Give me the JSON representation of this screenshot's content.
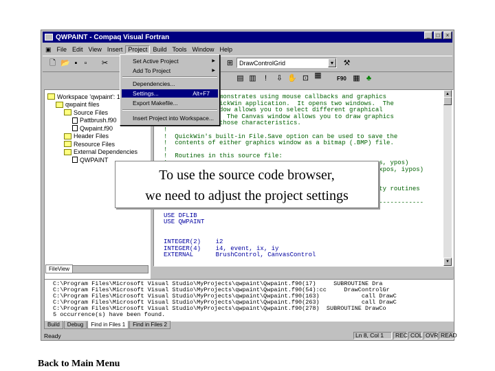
{
  "window": {
    "title": "QWPAINT - Compaq Visual Fortran"
  },
  "menubar": [
    "File",
    "Edit",
    "View",
    "Insert",
    "Project",
    "Build",
    "Tools",
    "Window",
    "Help"
  ],
  "toolbar": {
    "combo_value": "DrawControlGrid"
  },
  "project_menu": {
    "items": [
      {
        "label": "Set Active Project",
        "shortcut": "",
        "submenu": true
      },
      {
        "label": "Add To Project",
        "shortcut": "",
        "submenu": true
      },
      {
        "label": "Dependencies...",
        "shortcut": "",
        "submenu": false
      },
      {
        "label": "Settings...",
        "shortcut": "Alt+F7",
        "submenu": false,
        "selected": true
      },
      {
        "label": "Export Makefile...",
        "shortcut": "",
        "submenu": false
      },
      {
        "label": "Insert Project into Workspace...",
        "shortcut": "",
        "submenu": false
      }
    ]
  },
  "workspace_tree": {
    "items": [
      {
        "label": "Workspace 'qwpaint': 1 p",
        "level": 0,
        "icon": "workspace"
      },
      {
        "label": "qwpaint files",
        "level": 1,
        "icon": "project"
      },
      {
        "label": "Source Files",
        "level": 2,
        "icon": "folder"
      },
      {
        "label": "Pattbrush.f90",
        "level": 3,
        "icon": "file"
      },
      {
        "label": "Qwpaint.f90",
        "level": 3,
        "icon": "file"
      },
      {
        "label": "Header Files",
        "level": 2,
        "icon": "folder"
      },
      {
        "label": "Resource Files",
        "level": 2,
        "icon": "folder"
      },
      {
        "label": "External Dependencies",
        "level": 2,
        "icon": "folder"
      },
      {
        "label": "QWPAINT",
        "level": 3,
        "icon": "file"
      }
    ],
    "tab_label": "FileView"
  },
  "editor": {
    "lines": [
      {
        "t": "!      ...am demonstrates using mouse callbacks and graphics",
        "cls": "c"
      },
      {
        "t": "!      ... a QuickWin application.  It opens two windows.  The",
        "cls": "c"
      },
      {
        "t": "!      ...d window allows you to select different graphical",
        "cls": "c"
      },
      {
        "t": "!      ...tics.  The Canvas window allows you to draw graphics",
        "cls": "c"
      },
      {
        "t": "!      ...d on those characteristics.",
        "cls": "c"
      },
      {
        "t": "!",
        "cls": "c"
      },
      {
        "t": "!  QuickWin's built-in File.Save option can be used to save the",
        "cls": "c"
      },
      {
        "t": "!  contents of either graphics window as a bitmap (.BMP) file.",
        "cls": "c"
      },
      {
        "t": "!",
        "cls": "c"
      },
      {
        "t": "!  Routines in this source file:",
        "cls": "c"
      },
      {
        "t": "!                                                      xpos, ypos)",
        "cls": "c"
      },
      {
        "t": "!                                                      , ixpos, iypos)",
        "cls": "c"
      },
      {
        "t": "!",
        "cls": "c"
      },
      {
        "t": "!",
        "cls": "c"
      },
      {
        "t": "!                                                    utility routines",
        "cls": "c"
      },
      {
        "t": "!",
        "cls": "c"
      },
      {
        "t": "!---------------------------------------------------------------------",
        "cls": "c"
      },
      {
        "t": "",
        "cls": ""
      },
      {
        "t": "USE DFLIB",
        "cls": "k"
      },
      {
        "t": "USE QWPAINT",
        "cls": "k"
      },
      {
        "t": "",
        "cls": ""
      },
      {
        "t": "",
        "cls": ""
      },
      {
        "t": "INTEGER(2)    i2",
        "cls": "k"
      },
      {
        "t": "INTEGER(4)    i4, event, ix, iy",
        "cls": "k"
      },
      {
        "t": "EXTERNAL      BrushControl, CanvasControl",
        "cls": "k"
      }
    ]
  },
  "output_lines": [
    "C:\\Program Files\\Microsoft Visual Studio\\MyProjects\\qwpaint\\Qwpaint.f90(17)     SUBROUTINE Dra",
    "C:\\Program Files\\Microsoft Visual Studio\\MyProjects\\qwpaint\\Qwpaint.f90(54):cc     DrawControlGr",
    "C:\\Program Files\\Microsoft Visual Studio\\MyProjects\\qwpaint\\Qwpaint.f90(163)            call DrawC",
    "C:\\Program Files\\Microsoft Visual Studio\\MyProjects\\qwpaint\\Qwpaint.f90(263)            call DrawC",
    "C:\\Program Files\\Microsoft Visual Studio\\MyProjects\\qwpaint\\Qwpaint.f90(278)  SUBROUTINE DrawCo",
    "5 occurrence(s) have been found."
  ],
  "output_tabs": [
    "Build",
    "Debug",
    "Find in Files 1",
    "Find in Files 2"
  ],
  "statusbar": {
    "ready": "Ready",
    "position": "Ln 8, Col 1",
    "rec": "REC",
    "col": "COL",
    "ovr": "OVR",
    "read": "READ"
  },
  "callout": {
    "line1": "To use the source code browser,",
    "line2": "we need to adjust the project settings"
  },
  "footer": {
    "back_link": "Back to Main Menu"
  }
}
